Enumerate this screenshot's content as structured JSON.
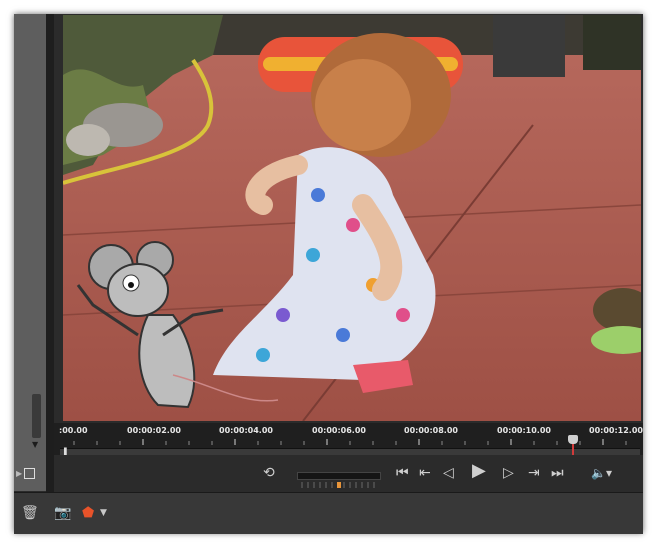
{
  "timeline": {
    "labels": [
      ":00.00",
      "00:00:02.00",
      "00:00:04.00",
      "00:00:06.00",
      "00:00:08.00",
      "00:00:10.00",
      "00:00:12.00"
    ]
  },
  "colors": {
    "playhead": "#d23b3b",
    "marker": "#e8532a",
    "panel": "#2b2b2b"
  },
  "icons": {
    "loop": "loop-icon",
    "go_start": "go-to-start-icon",
    "prev_edit": "previous-edit-icon",
    "prev_frame": "previous-frame-icon",
    "play": "play-icon",
    "next_frame": "next-frame-icon",
    "next_edit": "next-edit-icon",
    "go_end": "go-to-end-icon",
    "volume": "volume-icon",
    "trash": "trash-icon",
    "camera": "camera-icon",
    "marker": "marker-icon"
  }
}
